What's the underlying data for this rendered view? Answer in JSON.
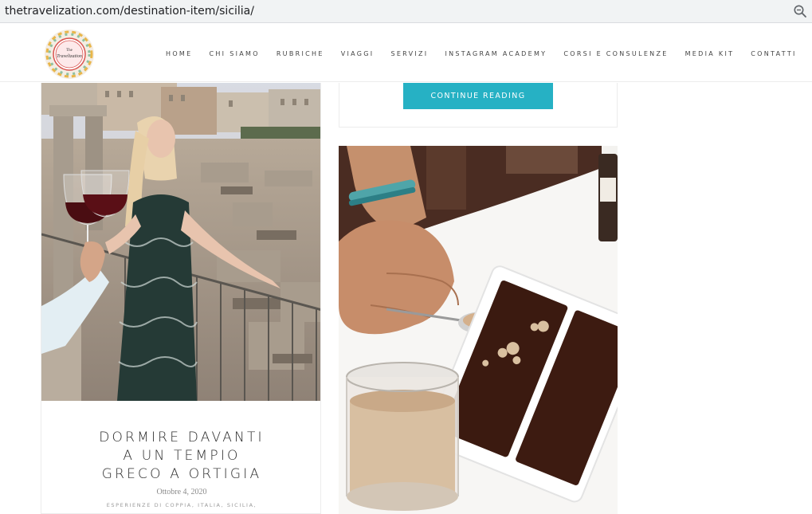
{
  "browser": {
    "url": "thetravelization.com/destination-item/sicilia/",
    "zoom_icon": "zoom-out-icon"
  },
  "header": {
    "logo_text": "The Travelization",
    "nav": [
      "HOME",
      "CHI SIAMO",
      "RUBRICHE",
      "VIAGGI",
      "SERVIZI",
      "INSTAGRAM ACADEMY",
      "CORSI E CONSULENZE",
      "MEDIA KIT",
      "CONTATTI"
    ]
  },
  "posts": {
    "continue_label": "CONTINUE READING",
    "left": {
      "title_lines": [
        "DORMIRE DAVANTI",
        "A UN TEMPIO",
        "GRECO A ORTIGIA"
      ],
      "date": "Ottobre 4, 2020",
      "categories": "ESPERIENZE DI COPPIA, ITALIA, SICILIA,"
    }
  },
  "colors": {
    "accent": "#26b1c4",
    "text": "#2b2b2b"
  }
}
